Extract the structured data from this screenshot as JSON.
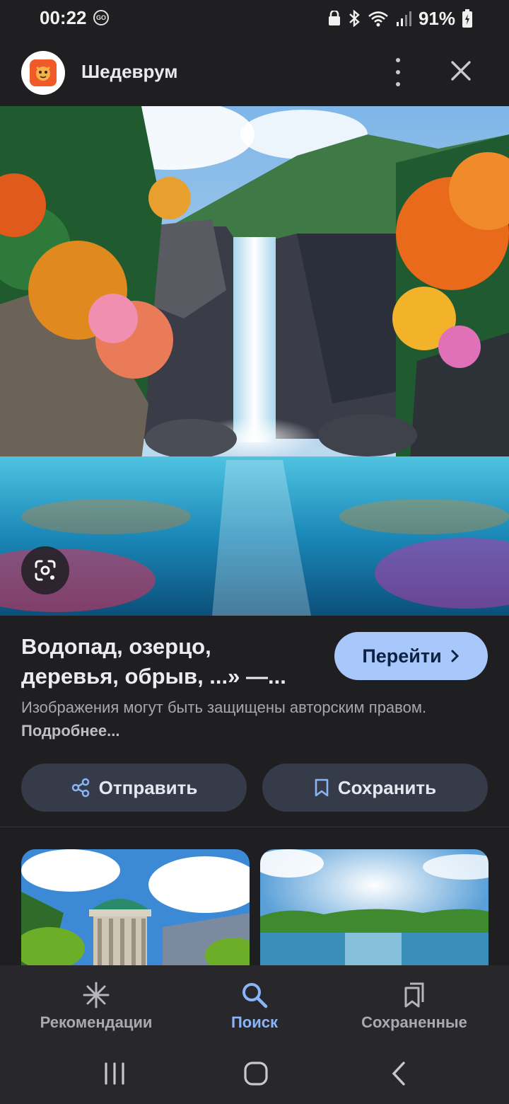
{
  "status_bar": {
    "time": "00:22",
    "go_badge": "GO",
    "battery_percent": "91%"
  },
  "header": {
    "title": "Шедеврум",
    "more_icon": "more-vert-icon",
    "close_icon": "close-icon"
  },
  "result": {
    "title_line1": "Водопад, озерцо,",
    "title_line2": "деревья, обрыв, ...» —...",
    "go_label": "Перейти",
    "copyright_text": "Изображения могут быть защищены авторским правом.",
    "copyright_link": "Подробнее..."
  },
  "actions": {
    "share_label": "Отправить",
    "save_label": "Сохранить"
  },
  "nav": {
    "items": [
      {
        "label": "Рекомендации",
        "icon": "asterisk-icon",
        "active": false
      },
      {
        "label": "Поиск",
        "icon": "search-icon",
        "active": true
      },
      {
        "label": "Сохраненные",
        "icon": "bookmarks-icon",
        "active": false
      }
    ]
  },
  "colors": {
    "accent": "#a8c7fa",
    "nav_active": "#8ab4f8",
    "background": "#1f1f21"
  }
}
